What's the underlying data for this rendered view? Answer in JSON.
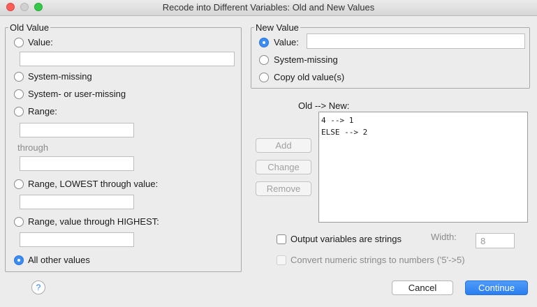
{
  "window": {
    "title": "Recode into Different Variables: Old and New Values"
  },
  "old_value": {
    "legend": "Old Value",
    "value_label": "Value:",
    "system_missing_label": "System-missing",
    "system_or_user_missing_label": "System- or user-missing",
    "range_label": "Range:",
    "through_label": "through",
    "range_lowest_label": "Range, LOWEST through value:",
    "range_highest_label": "Range, value through HIGHEST:",
    "all_other_label": "All other values",
    "selected": "All other values"
  },
  "new_value": {
    "legend": "New Value",
    "value_label": "Value:",
    "system_missing_label": "System-missing",
    "copy_old_label": "Copy old value(s)",
    "selected": "Value:",
    "value_input": ""
  },
  "mapping": {
    "label": "Old --> New:",
    "items": [
      "4 --> 1",
      "ELSE --> 2"
    ]
  },
  "actions": {
    "add": "Add",
    "change": "Change",
    "remove": "Remove"
  },
  "options": {
    "output_strings_label": "Output variables are strings",
    "width_label": "Width:",
    "width_value": "8",
    "convert_label": "Convert numeric strings to numbers ('5'->5)"
  },
  "footer": {
    "help": "?",
    "cancel": "Cancel",
    "continue": "Continue"
  },
  "colors": {
    "accent": "#2a7ef0",
    "close": "#fc5f57",
    "maximize": "#35c94a"
  }
}
